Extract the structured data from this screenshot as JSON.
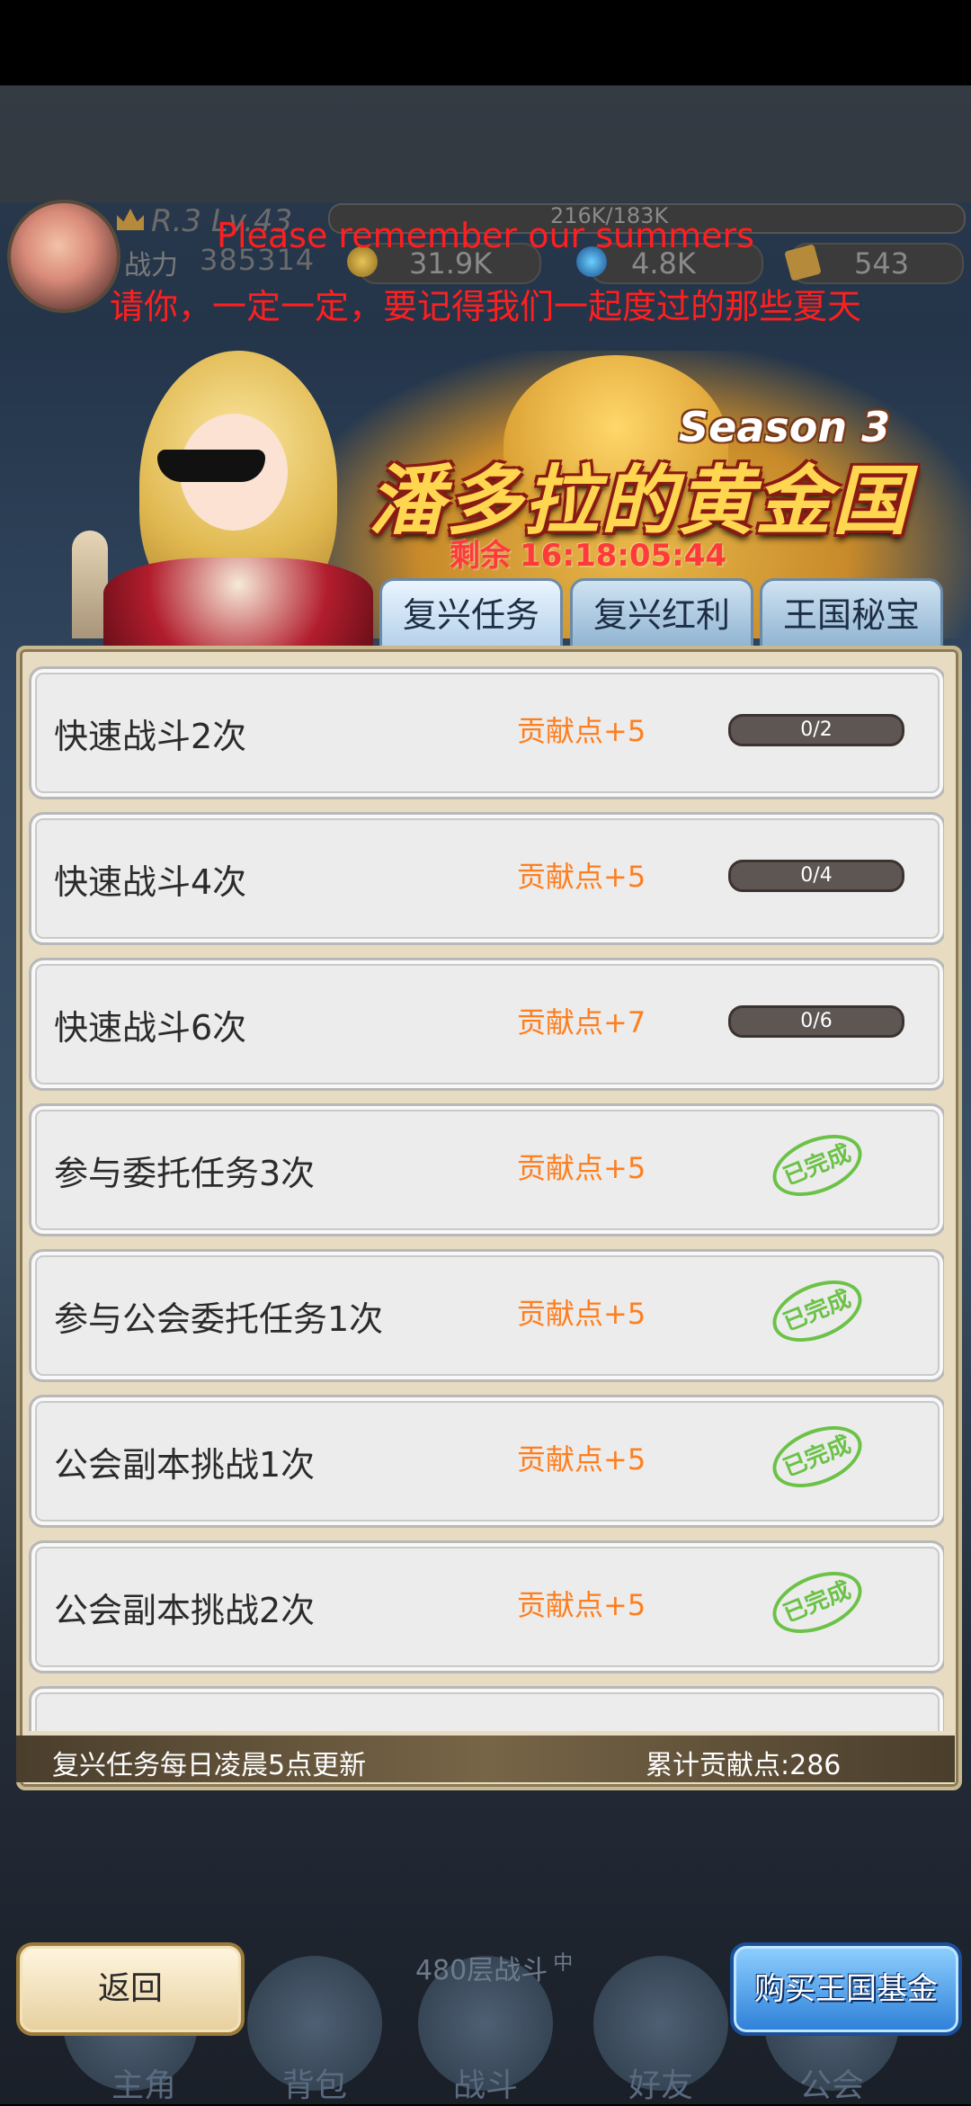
{
  "header": {
    "rank": "R.3 Lv.43",
    "power_label": "战力",
    "power_value": "385314",
    "exp_text": "216K/183K",
    "gold": "31.9K",
    "gems": "4.8K",
    "tickets": "543"
  },
  "announcement": {
    "line1": "Please remember our summers",
    "line2": "请你，一定一定，要记得我们一起度过的那些夏天"
  },
  "event": {
    "season": "Season 3",
    "title": "潘多拉的黄金国",
    "remaining_label": "剩余",
    "remaining_time": "16:18:05:44"
  },
  "tabs": [
    {
      "label": "复兴任务"
    },
    {
      "label": "复兴红利"
    },
    {
      "label": "王国秘宝"
    }
  ],
  "tasks": [
    {
      "name": "快速战斗2次",
      "reward": "贡献点+5",
      "status": "0/2"
    },
    {
      "name": "快速战斗4次",
      "reward": "贡献点+5",
      "status": "0/4"
    },
    {
      "name": "快速战斗6次",
      "reward": "贡献点+7",
      "status": "0/6"
    },
    {
      "name": "参与委托任务3次",
      "reward": "贡献点+5",
      "status": "已完成"
    },
    {
      "name": "参与公会委托任务1次",
      "reward": "贡献点+5",
      "status": "已完成"
    },
    {
      "name": "公会副本挑战1次",
      "reward": "贡献点+5",
      "status": "已完成"
    },
    {
      "name": "公会副本挑战2次",
      "reward": "贡献点+5",
      "status": "已完成"
    }
  ],
  "footer": {
    "note": "复兴任务每日凌晨5点更新",
    "points": "累计贡献点:286"
  },
  "bottom": {
    "floor_text": "480层战斗",
    "floor_sup": "中",
    "back_label": "返回",
    "buy_label": "购买王国基金",
    "nav": [
      "主角",
      "背包",
      "战斗",
      "好友",
      "公会"
    ]
  }
}
